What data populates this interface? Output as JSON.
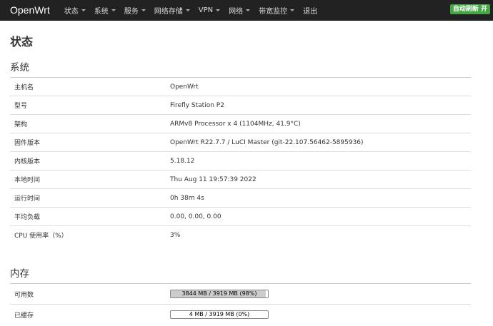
{
  "header": {
    "brand": "OpenWrt",
    "nav": [
      {
        "label": "状态",
        "dropdown": true
      },
      {
        "label": "系统",
        "dropdown": true
      },
      {
        "label": "服务",
        "dropdown": true
      },
      {
        "label": "网络存储",
        "dropdown": true
      },
      {
        "label": "VPN",
        "dropdown": true
      },
      {
        "label": "网络",
        "dropdown": true
      },
      {
        "label": "带宽监控",
        "dropdown": true
      },
      {
        "label": "退出",
        "dropdown": false
      }
    ],
    "autorefresh": "自动刷新 开",
    "autorefresh_color": "#46a546"
  },
  "page_title": "状态",
  "system": {
    "title": "系统",
    "rows": [
      {
        "key": "主机名",
        "value": "OpenWrt"
      },
      {
        "key": "型号",
        "value": "Firefly Station P2"
      },
      {
        "key": "架构",
        "value": "ARMv8 Processor x 4 (1104MHz, 41.9°C)"
      },
      {
        "key": "固件版本",
        "value": "OpenWrt R22.7.7 / LuCI Master (git-22.107.56462-5895936)"
      },
      {
        "key": "内核版本",
        "value": "5.18.12"
      },
      {
        "key": "本地时间",
        "value": "Thu Aug 11 19:57:39 2022"
      },
      {
        "key": "运行时间",
        "value": "0h 38m 4s"
      },
      {
        "key": "平均负载",
        "value": "0.00, 0.00, 0.00"
      },
      {
        "key": "CPU 使用率（%）",
        "value": "3%"
      }
    ]
  },
  "memory": {
    "title": "内存",
    "rows": [
      {
        "key": "可用数",
        "bar_label": "3844 MB / 3919 MB (98%)",
        "percent": 98
      },
      {
        "key": "已缓存",
        "bar_label": "4 MB / 3919 MB (0%)",
        "percent": 0
      }
    ]
  }
}
